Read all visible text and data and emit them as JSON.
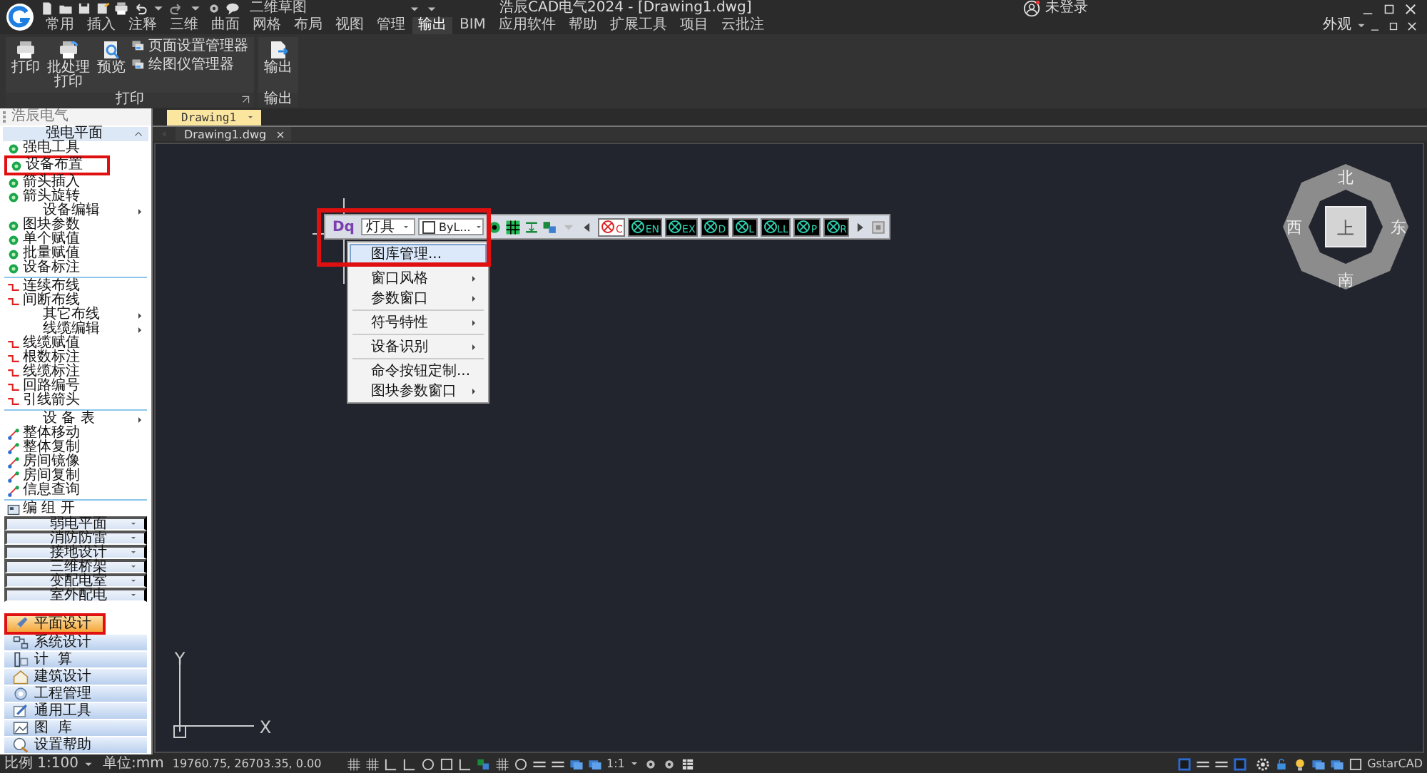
{
  "title_bar": {
    "workspace": "二维草图",
    "title": "浩辰CAD电气2024 - [Drawing1.dwg]",
    "user": "未登录"
  },
  "ribbon": {
    "tabs": [
      {
        "label": "常用",
        "selected": false
      },
      {
        "label": "插入",
        "selected": false
      },
      {
        "label": "注释",
        "selected": false
      },
      {
        "label": "三维",
        "selected": false
      },
      {
        "label": "曲面",
        "selected": false
      },
      {
        "label": "网格",
        "selected": false
      },
      {
        "label": "布局",
        "selected": false
      },
      {
        "label": "视图",
        "selected": false
      },
      {
        "label": "管理",
        "selected": false
      },
      {
        "label": "输出",
        "selected": true
      },
      {
        "label": "BIM",
        "selected": false
      },
      {
        "label": "应用软件",
        "selected": false
      },
      {
        "label": "帮助",
        "selected": false
      },
      {
        "label": "扩展工具",
        "selected": false
      },
      {
        "label": "项目",
        "selected": false
      },
      {
        "label": "云批注",
        "selected": false
      }
    ],
    "appearance": "外观",
    "panels": [
      {
        "title": "打印",
        "dialog_launcher": true,
        "buttons": [
          {
            "kind": "large",
            "label": "打印"
          },
          {
            "kind": "large",
            "label": "批处理打印"
          },
          {
            "kind": "large",
            "label": "预览"
          },
          {
            "kind": "small",
            "label": "页面设置管理器"
          },
          {
            "kind": "small",
            "label": "绘图仪管理器"
          }
        ]
      },
      {
        "title": "输出",
        "dialog_launcher": false,
        "buttons": [
          {
            "kind": "large",
            "label": "输出"
          }
        ]
      }
    ]
  },
  "sidebar": {
    "title": "浩辰电气",
    "sections": [
      {
        "label": "强电平面",
        "expanded": true,
        "groups": [
          [
            {
              "kind": "tool",
              "label": "强电工具",
              "annotated": false
            },
            {
              "kind": "tool",
              "label": "设备布置",
              "annotated": true
            },
            {
              "kind": "tool",
              "label": "箭头插入",
              "annotated": false
            },
            {
              "kind": "tool",
              "label": "箭头旋转",
              "annotated": false
            },
            {
              "kind": "submenu",
              "label": "设备编辑",
              "annotated": false
            },
            {
              "kind": "tool",
              "label": "图块参数",
              "annotated": false
            },
            {
              "kind": "tool",
              "label": "单个赋值",
              "annotated": false
            },
            {
              "kind": "tool",
              "label": "批量赋值",
              "annotated": false
            },
            {
              "kind": "tool",
              "label": "设备标注",
              "annotated": false
            }
          ],
          [
            {
              "kind": "tool",
              "label": "连续布线",
              "annotated": false
            },
            {
              "kind": "tool",
              "label": "间断布线",
              "annotated": false
            },
            {
              "kind": "submenu",
              "label": "其它布线",
              "annotated": false
            },
            {
              "kind": "submenu",
              "label": "线缆编辑",
              "annotated": false
            },
            {
              "kind": "tool",
              "label": "线缆赋值",
              "annotated": false
            },
            {
              "kind": "tool",
              "label": "根数标注",
              "annotated": false
            },
            {
              "kind": "tool",
              "label": "线缆标注",
              "annotated": false
            },
            {
              "kind": "tool",
              "label": "回路编号",
              "annotated": false
            },
            {
              "kind": "tool",
              "label": "引线箭头",
              "annotated": false
            }
          ],
          [
            {
              "kind": "submenu",
              "label": "设 备 表",
              "annotated": false
            },
            {
              "kind": "tool",
              "label": "整体移动",
              "annotated": false
            },
            {
              "kind": "tool",
              "label": "整体复制",
              "annotated": false
            },
            {
              "kind": "tool",
              "label": "房间镜像",
              "annotated": false
            },
            {
              "kind": "tool",
              "label": "房间复制",
              "annotated": false
            },
            {
              "kind": "tool",
              "label": "信息查询",
              "annotated": false
            }
          ],
          [
            {
              "kind": "tool",
              "label": "编 组 开",
              "annotated": false
            }
          ]
        ]
      },
      {
        "label": "弱电平面",
        "expanded": false
      },
      {
        "label": "消防防雷",
        "expanded": false
      },
      {
        "label": "接地设计",
        "expanded": false
      },
      {
        "label": "三维桥架",
        "expanded": false
      },
      {
        "label": "变配电室",
        "expanded": false
      },
      {
        "label": "室外配电",
        "expanded": false
      }
    ],
    "nav": [
      {
        "label": "平面设计",
        "selected": true,
        "annotated": true
      },
      {
        "label": "系统设计",
        "selected": false,
        "annotated": false
      },
      {
        "label": "计  算",
        "selected": false,
        "annotated": false
      },
      {
        "label": "建筑设计",
        "selected": false,
        "annotated": false
      },
      {
        "label": "工程管理",
        "selected": false,
        "annotated": false
      },
      {
        "label": "通用工具",
        "selected": false,
        "annotated": false
      },
      {
        "label": "图  库",
        "selected": false,
        "annotated": false
      },
      {
        "label": "设置帮助",
        "selected": false,
        "annotated": false
      }
    ]
  },
  "document": {
    "file_tabs": [
      {
        "label": "Drawing1"
      }
    ],
    "drawing_tab": "Drawing1.dwg",
    "toolbar": {
      "label": "Dq",
      "category": "灯具",
      "layer": "ByL...",
      "annotated": true,
      "symbols": [
        {
          "label": "C",
          "selected": true
        },
        {
          "label": "EN",
          "selected": false
        },
        {
          "label": "EX",
          "selected": false
        },
        {
          "label": "D",
          "selected": false
        },
        {
          "label": "L",
          "selected": false
        },
        {
          "label": "LL",
          "selected": false
        },
        {
          "label": "P",
          "selected": false
        },
        {
          "label": "R",
          "selected": false
        }
      ]
    },
    "menu": [
      [
        {
          "label": "图库管理...",
          "submenu": false,
          "selected": true
        }
      ],
      [
        {
          "label": "窗口风格",
          "submenu": true,
          "selected": false
        },
        {
          "label": "参数窗口",
          "submenu": true,
          "selected": false
        }
      ],
      [
        {
          "label": "符号特性",
          "submenu": true,
          "selected": false
        }
      ],
      [
        {
          "label": "设备识别",
          "submenu": true,
          "selected": false
        }
      ],
      [
        {
          "label": "命令按钮定制...",
          "submenu": false,
          "selected": false
        },
        {
          "label": "图块参数窗口",
          "submenu": true,
          "selected": false
        }
      ]
    ],
    "view_cube": {
      "north": "北",
      "south": "南",
      "west": "西",
      "east": "东",
      "top": "上"
    },
    "ucs": {
      "x": "X",
      "y": "Y"
    }
  },
  "status_bar": {
    "scale": "比例 1:100",
    "units": "单位:mm",
    "coordinates": "19760.75, 26703.35, 0.00",
    "annotation_scale": "1:1",
    "brand": "GstarCAD"
  }
}
